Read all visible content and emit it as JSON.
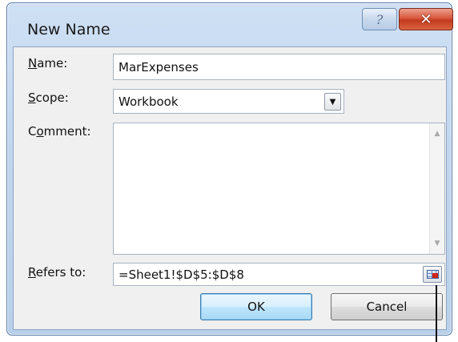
{
  "window": {
    "title": "New Name",
    "help_glyph": "?",
    "close_glyph": "✕"
  },
  "form": {
    "name_label_accel": "N",
    "name_label_rest": "ame:",
    "name_value": "MarExpenses",
    "scope_label_accel": "S",
    "scope_label_rest": "cope:",
    "scope_value": "Workbook",
    "comment_label_pre": "C",
    "comment_label_accel": "o",
    "comment_label_rest": "mment:",
    "comment_value": "",
    "refers_label_accel": "R",
    "refers_label_rest": "efers to:",
    "refers_value": "=Sheet1!$D$5:$D$8"
  },
  "buttons": {
    "ok": "OK",
    "cancel": "Cancel"
  },
  "icons": {
    "help": "help-icon",
    "close": "close-icon",
    "dropdown": "chevron-down-icon",
    "scroll_up": "scroll-up-arrow-icon",
    "scroll_down": "scroll-down-arrow-icon",
    "collapse_dialog": "collapse-dialog-icon"
  }
}
